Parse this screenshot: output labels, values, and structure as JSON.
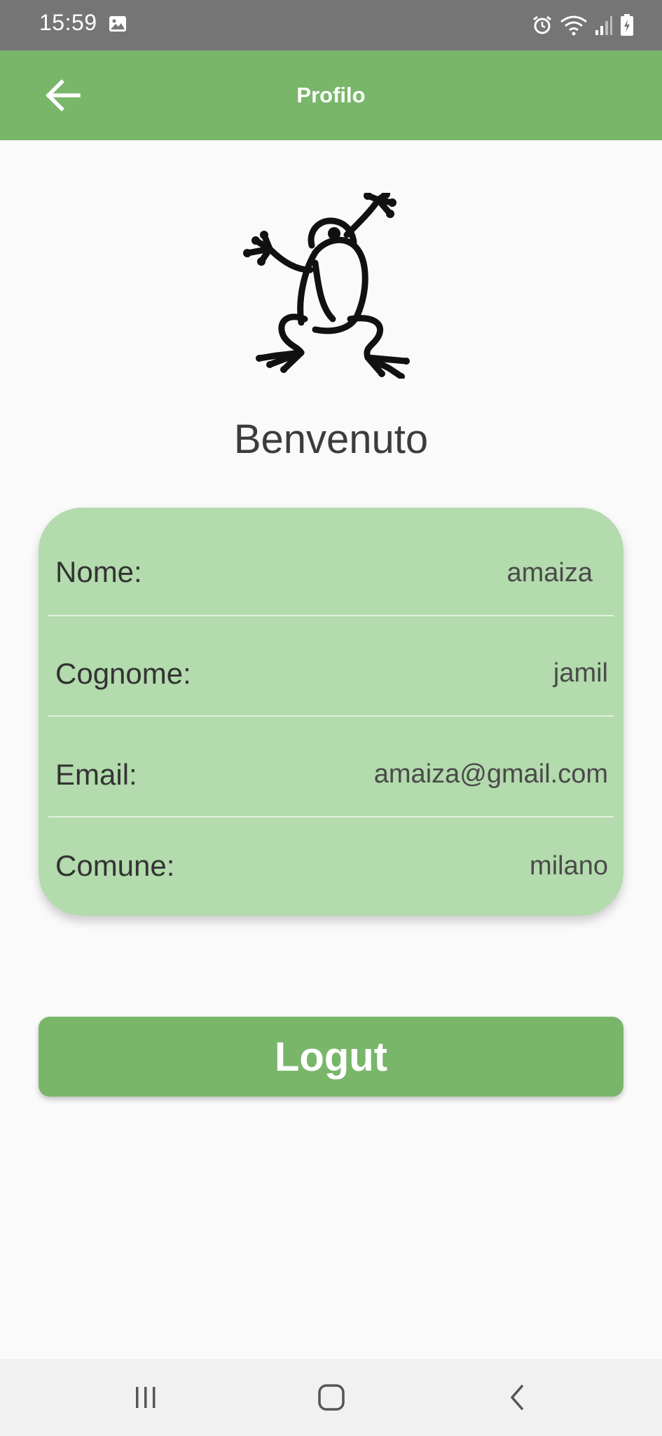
{
  "status_bar": {
    "time": "15:59",
    "icons": [
      "gallery-icon",
      "alarm-icon",
      "wifi-icon",
      "signal-icon",
      "battery-icon"
    ]
  },
  "app_bar": {
    "title": "Profilo",
    "back_icon": "arrow-back-icon"
  },
  "logo": {
    "icon": "frog-icon"
  },
  "welcome_text": "Benvenuto",
  "profile": {
    "rows": [
      {
        "label": "Nome:",
        "value": "amaiza"
      },
      {
        "label": "Cognome:",
        "value": "jamil"
      },
      {
        "label": "Email:",
        "value": "amaiza@gmail.com"
      },
      {
        "label": "Comune:",
        "value": "milano"
      }
    ]
  },
  "logout_label": "Logut",
  "nav_bar": {
    "icons": [
      "recent-apps-icon",
      "home-icon",
      "back-icon"
    ]
  },
  "colors": {
    "accent": "#79b66a",
    "card": "#b3dbad",
    "status_bar": "#757575",
    "background": "#fafafa"
  }
}
